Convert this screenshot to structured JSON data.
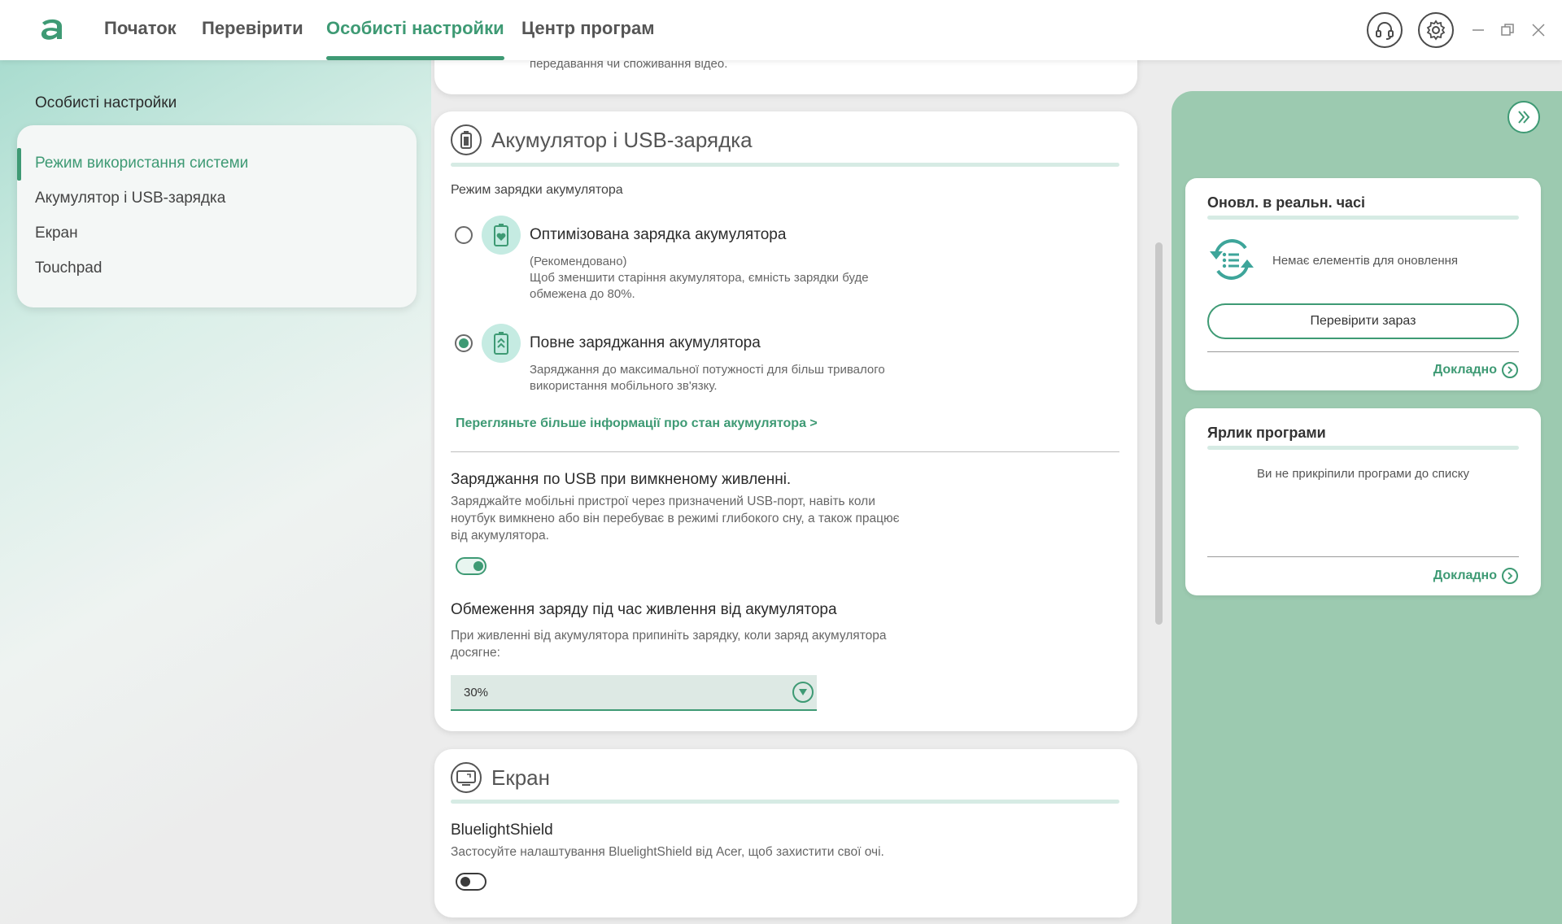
{
  "app": {
    "tabs": [
      {
        "label": "Початок"
      },
      {
        "label": "Перевірити"
      },
      {
        "label": "Особисті настройки"
      },
      {
        "label": "Центр програм"
      }
    ],
    "active_tab": 2,
    "accent_color": "#3e9a74"
  },
  "sidebar": {
    "heading": "Особисті настройки",
    "items": [
      {
        "label": "Режим використання системи"
      },
      {
        "label": "Акумулятор і USB-зарядка"
      },
      {
        "label": "Екран"
      },
      {
        "label": "Touchpad"
      }
    ]
  },
  "top_card": {
    "tail_text": "передавання чи споживання відео."
  },
  "battery_card": {
    "title": "Акумулятор і USB-зарядка",
    "icon": "battery-icon",
    "mode_label": "Режим зарядки акумулятора",
    "options": [
      {
        "title": "Оптимізована зарядка акумулятора",
        "recommended": "(Рекомендовано)",
        "desc": "Щоб зменшити старіння акумулятора, ємність зарядки буде обмежена до 80%.",
        "selected": false,
        "icon": "battery-heart-icon"
      },
      {
        "title": "Повне заряджання акумулятора",
        "desc": "Заряджання до максимальної потужності для більш тривалого використання мобільного зв'язку.",
        "selected": true,
        "icon": "battery-full-icon"
      }
    ],
    "more_info_link": "Перегляньте більше інформації про стан акумулятора >",
    "usb": {
      "title": "Заряджання по USB при вимкненому живленні.",
      "desc": "Заряджайте мобільні пристрої через призначений USB-порт, навіть коли ноутбук вимкнено або він перебуває в режимі глибокого сну, а також працює від акумулятора.",
      "enabled": true
    },
    "limit": {
      "title": "Обмеження заряду під час живлення від акумулятора",
      "desc": "При живленні від акумулятора припиніть зарядку, коли заряд акумулятора досягне:",
      "value": "30%"
    }
  },
  "screen_card": {
    "title": "Екран",
    "icon": "screen-icon",
    "bluelight": {
      "title": "BluelightShield",
      "desc": "Застосуйте налаштування BluelightShield від Acer, щоб захистити свої очі.",
      "enabled": false
    }
  },
  "right_panel": {
    "updates": {
      "title": "Оновл. в реальн. часі",
      "status": "Немає елементів для оновлення",
      "check_button": "Перевірити зараз",
      "more": "Докладно"
    },
    "shortcuts": {
      "title": "Ярлик програми",
      "empty": "Ви не прикріпили програми до списку",
      "more": "Докладно"
    }
  }
}
